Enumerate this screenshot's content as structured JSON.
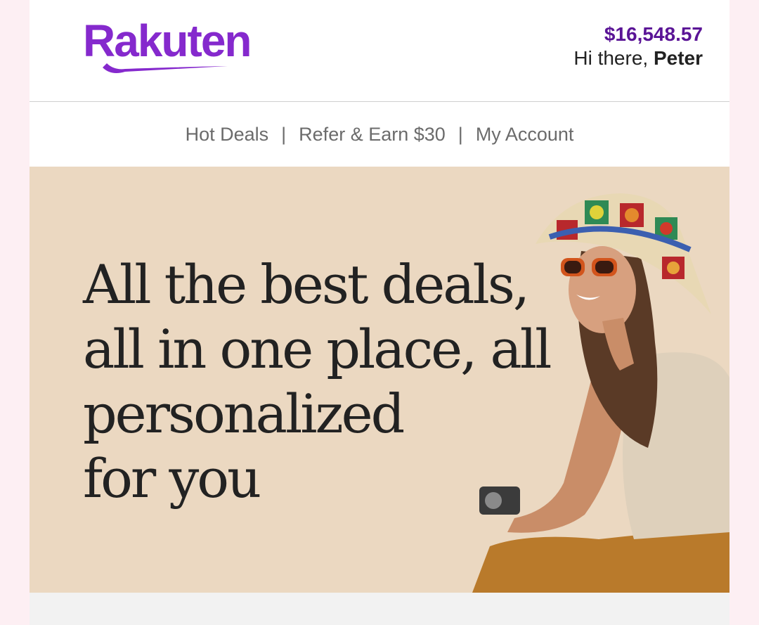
{
  "brand": {
    "name": "Rakuten",
    "color": "#8529cd"
  },
  "account": {
    "balance": "$16,548.57",
    "greeting_prefix": "Hi there, ",
    "user_name": "Peter",
    "balance_color": "#5a1496"
  },
  "nav": {
    "items": [
      {
        "label": "Hot Deals"
      },
      {
        "label": "Refer & Earn $30"
      },
      {
        "label": "My Account"
      }
    ],
    "separator": "|"
  },
  "hero": {
    "lines": [
      "All the best deals,",
      "all in one place, all",
      "personalized",
      "for you"
    ],
    "background_color": "#ebd8c1"
  }
}
